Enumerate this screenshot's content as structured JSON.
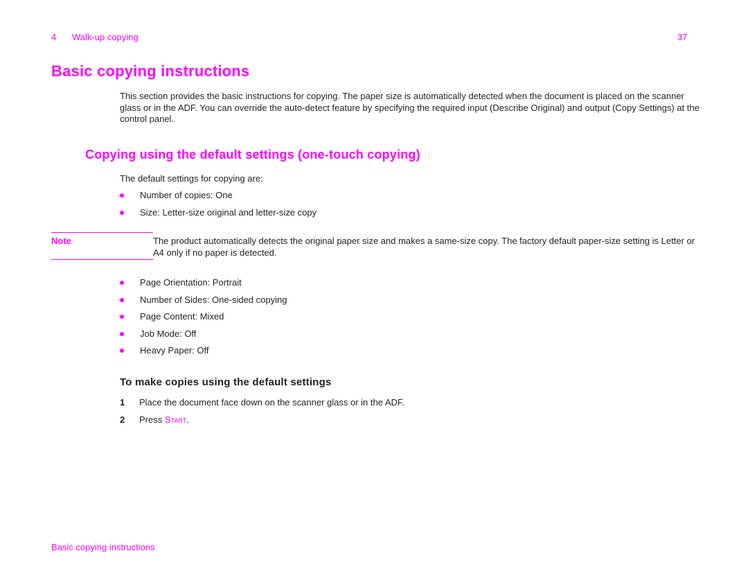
{
  "header": {
    "chapter_number": "4",
    "chapter_title": "Walk-up copying",
    "page_number": "37"
  },
  "title": "Basic copying instructions",
  "intro": "This section provides the basic instructions for copying. The paper size is automatically detected when the document is placed on the scanner glass or in the ADF. You can override the auto-detect feature by specifying the required input (Describe Original) and output (Copy Settings) at the control panel.",
  "section": {
    "heading": "Copying using the default settings (one-touch copying)",
    "lead": "The default settings for copying are:",
    "defaults_part1": [
      "Number of copies: One",
      "Size: Letter-size original and letter-size copy"
    ],
    "note": {
      "label": "Note",
      "text": "The product automatically detects the original paper size and makes a same-size copy. The factory default paper-size setting is Letter or A4 only if no paper is detected."
    },
    "defaults_part2": [
      "Page Orientation: Portrait",
      "Number of Sides: One-sided copying",
      "Page Content: Mixed",
      "Job Mode: Off",
      "Heavy Paper: Off"
    ]
  },
  "procedure": {
    "heading": "To make copies using the default settings",
    "steps": [
      {
        "number": "1",
        "text": "Place the document face down on the scanner glass or in the ADF."
      },
      {
        "number": "2",
        "text_before": "Press ",
        "key": "Start",
        "text_after": "."
      }
    ]
  },
  "footer": {
    "section_title": "Basic copying instructions"
  },
  "colors": {
    "accent": "#ff00ff",
    "body_text": "#231f20"
  }
}
